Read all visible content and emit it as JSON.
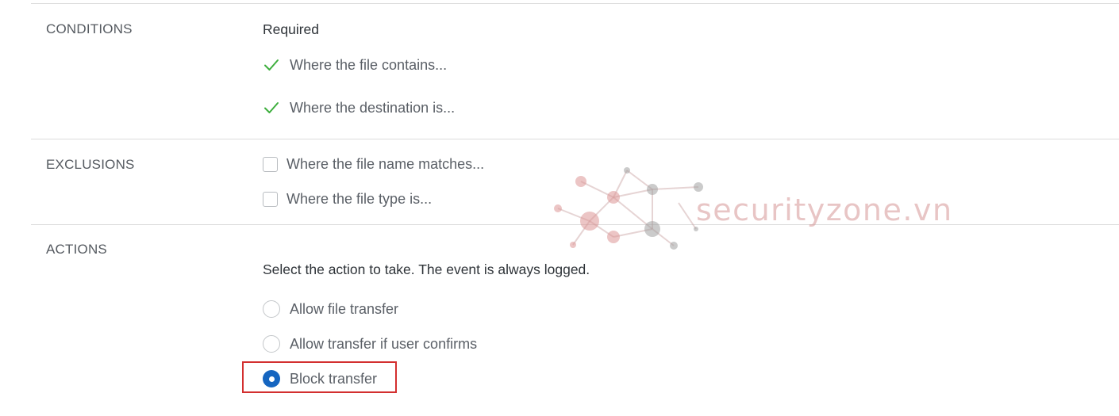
{
  "conditions": {
    "section_label": "CONDITIONS",
    "required_label": "Required",
    "items": [
      {
        "label": "Where the file contains...",
        "icon": "check-icon"
      },
      {
        "label": "Where the destination is...",
        "icon": "check-icon"
      }
    ]
  },
  "exclusions": {
    "section_label": "EXCLUSIONS",
    "items": [
      {
        "label": "Where the file name matches...",
        "checked": false
      },
      {
        "label": "Where the file type is...",
        "checked": false
      }
    ]
  },
  "actions": {
    "section_label": "ACTIONS",
    "description": "Select the action to take. The event is always logged.",
    "options": [
      {
        "label": "Allow file transfer",
        "selected": false
      },
      {
        "label": "Allow transfer if user confirms",
        "selected": false
      },
      {
        "label": "Block transfer",
        "selected": true
      }
    ]
  },
  "watermark": {
    "text": "securityzone.vn",
    "icon": "network-graph-logo"
  },
  "colors": {
    "check_green": "#3dae3d",
    "radio_selected": "#1565c0",
    "highlight_red": "#d32f2f"
  }
}
